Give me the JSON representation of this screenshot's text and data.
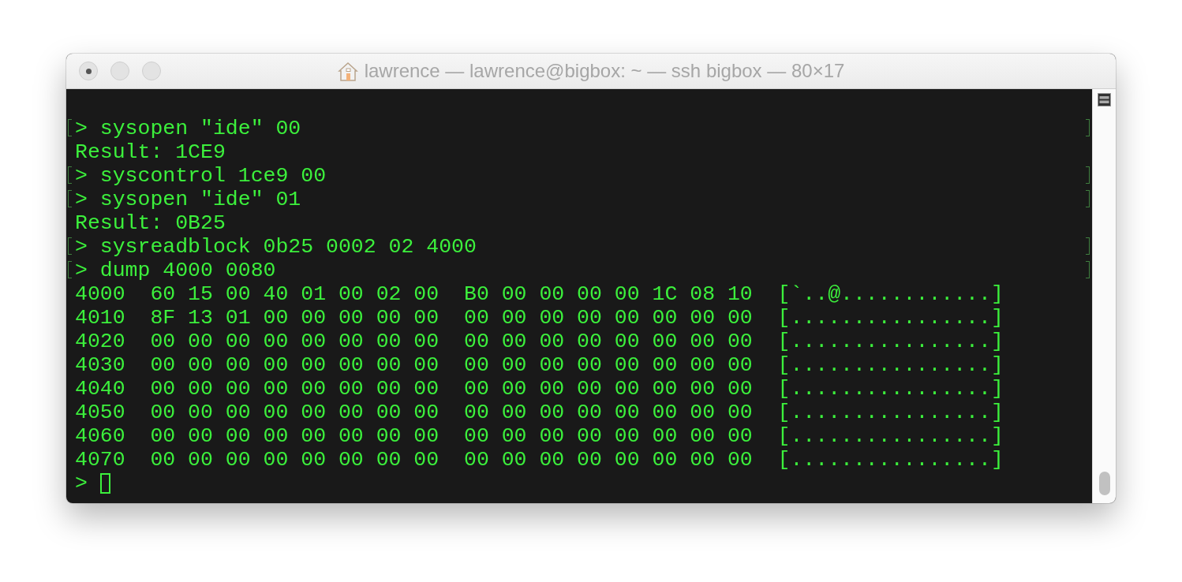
{
  "window": {
    "title": "lawrence — lawrence@bigbox: ~ — ssh bigbox — 80×17",
    "buttons": [
      {
        "dot": true
      },
      {
        "dot": false
      },
      {
        "dot": false
      }
    ]
  },
  "terminal": {
    "lines": [
      {
        "text": "> sysopen \"ide\" 00",
        "marked": true
      },
      {
        "text": "Result: 1CE9",
        "marked": false
      },
      {
        "text": "> syscontrol 1ce9 00",
        "marked": true
      },
      {
        "text": "> sysopen \"ide\" 01",
        "marked": true
      },
      {
        "text": "Result: 0B25",
        "marked": false
      },
      {
        "text": "> sysreadblock 0b25 0002 02 4000",
        "marked": true
      },
      {
        "text": "> dump 4000 0080",
        "marked": true
      },
      {
        "text": "4000  60 15 00 40 01 00 02 00  B0 00 00 00 00 1C 08 10  [`..@............]",
        "marked": false
      },
      {
        "text": "4010  8F 13 01 00 00 00 00 00  00 00 00 00 00 00 00 00  [................]",
        "marked": false
      },
      {
        "text": "4020  00 00 00 00 00 00 00 00  00 00 00 00 00 00 00 00  [................]",
        "marked": false
      },
      {
        "text": "4030  00 00 00 00 00 00 00 00  00 00 00 00 00 00 00 00  [................]",
        "marked": false
      },
      {
        "text": "4040  00 00 00 00 00 00 00 00  00 00 00 00 00 00 00 00  [................]",
        "marked": false
      },
      {
        "text": "4050  00 00 00 00 00 00 00 00  00 00 00 00 00 00 00 00  [................]",
        "marked": false
      },
      {
        "text": "4060  00 00 00 00 00 00 00 00  00 00 00 00 00 00 00 00  [................]",
        "marked": false
      },
      {
        "text": "4070  00 00 00 00 00 00 00 00  00 00 00 00 00 00 00 00  [................]",
        "marked": false
      }
    ],
    "prompt": ">"
  }
}
